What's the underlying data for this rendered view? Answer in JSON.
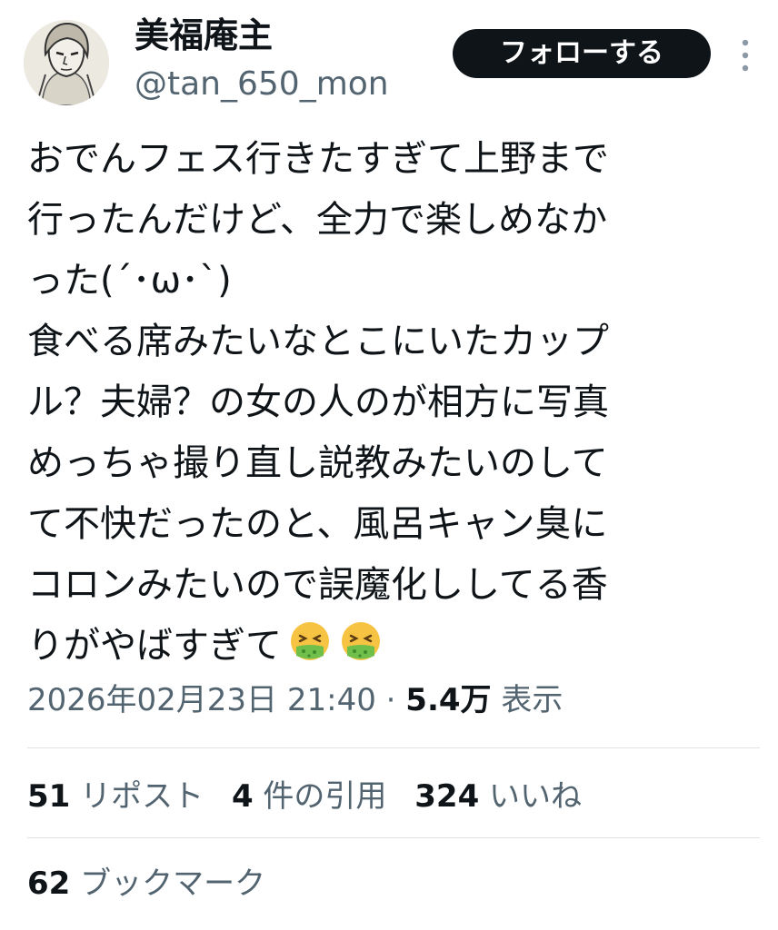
{
  "header": {
    "display_name": "美福庵主",
    "handle": "@tan_650_mon",
    "follow_label": "フォローする"
  },
  "tweet": {
    "lines": [
      "おでんフェス行きたすぎて上野まで",
      "行ったんだけど、全力で楽しめなか",
      "った(´･ω･`)",
      "食べる席みたいなとこにいたカップ",
      "ル？夫婦？の女の人のが相方に写真",
      "めっちゃ撮り直し説教みたいのして",
      "て不快だったのと、風呂キャン臭に",
      "コロンみたいので誤魔化ししてる香",
      "りがやばすぎて"
    ],
    "trailing_emojis": [
      "nauseated-face-emoji",
      "nauseated-face-emoji"
    ]
  },
  "meta": {
    "timestamp": "2026年02月23日 21:40",
    "separator": " · ",
    "views_count": "5.4万",
    "views_label": " 表示"
  },
  "stats": {
    "reposts_count": "51",
    "reposts_label": " リポスト",
    "quotes_count": "4",
    "quotes_label": " 件の引用",
    "likes_count": "324",
    "likes_label": " いいね",
    "bookmarks_count": "62",
    "bookmarks_label": " ブックマーク"
  },
  "colors": {
    "text_primary": "#0f1419",
    "text_secondary": "#536471",
    "divider": "#dfe3e6",
    "follow_bg": "#0f1419",
    "follow_text": "#ffffff"
  }
}
